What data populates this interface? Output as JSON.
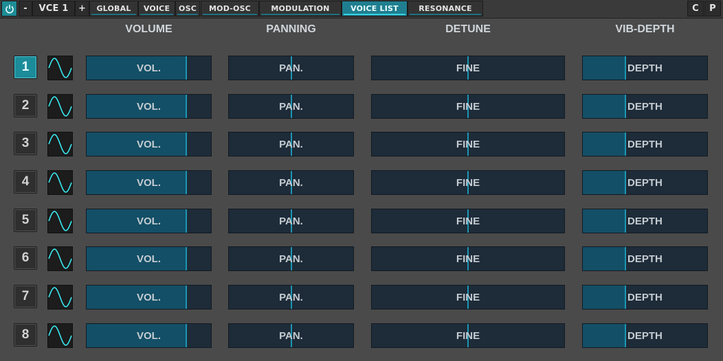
{
  "topbar": {
    "power_icon": "power-icon",
    "minus_label": "-",
    "voice_select": "VCE 1",
    "plus_label": "+",
    "tabs": [
      {
        "label": "GLOBAL",
        "active": false
      },
      {
        "label": "VOICE",
        "active": false
      },
      {
        "label": "OSC",
        "active": false
      },
      {
        "label": "MOD-OSC",
        "active": false
      },
      {
        "label": "MODULATION",
        "active": false
      },
      {
        "label": "VOICE LIST",
        "active": true
      },
      {
        "label": "RESONANCE",
        "active": false
      }
    ],
    "c_label": "C",
    "p_label": "P"
  },
  "headers": {
    "volume": "VOLUME",
    "panning": "PANNING",
    "detune": "DETUNE",
    "vib_depth": "VIB-DEPTH"
  },
  "slider_labels": {
    "volume": "VOL.",
    "panning": "PAN.",
    "detune": "FINE",
    "depth": "DEPTH"
  },
  "voices": [
    {
      "number": "1",
      "active": true,
      "waveform": "sine-wave-icon",
      "volume": 0.8,
      "panning": 0.5,
      "detune": 0.5,
      "depth": 0.34
    },
    {
      "number": "2",
      "active": false,
      "waveform": "sine-wave-icon",
      "volume": 0.8,
      "panning": 0.5,
      "detune": 0.5,
      "depth": 0.34
    },
    {
      "number": "3",
      "active": false,
      "waveform": "sine-wave-icon",
      "volume": 0.8,
      "panning": 0.5,
      "detune": 0.5,
      "depth": 0.34
    },
    {
      "number": "4",
      "active": false,
      "waveform": "sine-wave-icon",
      "volume": 0.8,
      "panning": 0.5,
      "detune": 0.5,
      "depth": 0.34
    },
    {
      "number": "5",
      "active": false,
      "waveform": "sine-wave-icon",
      "volume": 0.8,
      "panning": 0.5,
      "detune": 0.5,
      "depth": 0.34
    },
    {
      "number": "6",
      "active": false,
      "waveform": "sine-wave-icon",
      "volume": 0.8,
      "panning": 0.5,
      "detune": 0.5,
      "depth": 0.34
    },
    {
      "number": "7",
      "active": false,
      "waveform": "sine-wave-icon",
      "volume": 0.8,
      "panning": 0.5,
      "detune": 0.5,
      "depth": 0.34
    },
    {
      "number": "8",
      "active": false,
      "waveform": "sine-wave-icon",
      "volume": 0.8,
      "panning": 0.5,
      "detune": 0.5,
      "depth": 0.34
    }
  ],
  "colors": {
    "accent": "#1d8c9a",
    "slider_bg": "#1e2b38",
    "slider_fill": "#134f66",
    "slider_edge": "#1b96b3",
    "wave": "#38e8f0"
  }
}
